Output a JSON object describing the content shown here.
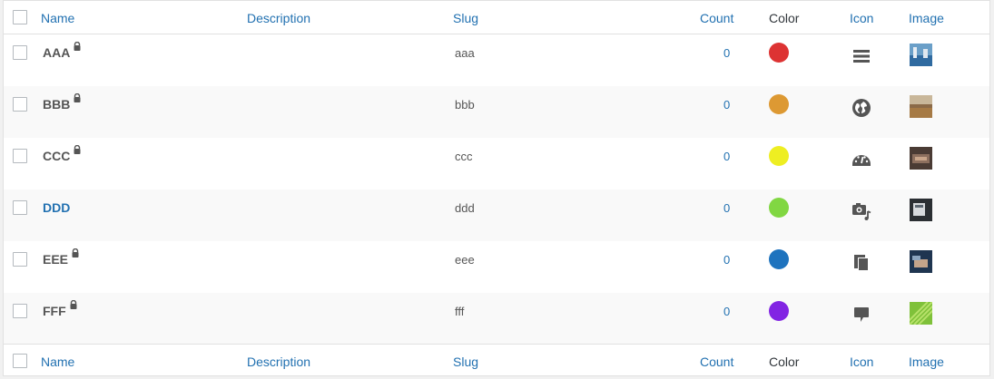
{
  "columns": {
    "name": "Name",
    "description": "Description",
    "slug": "Slug",
    "count": "Count",
    "color": "Color",
    "icon": "Icon",
    "image": "Image"
  },
  "rows": [
    {
      "name": "AAA",
      "slug": "aaa",
      "count": "0",
      "color": "#dd3333",
      "icon": "menu-icon",
      "locked": true
    },
    {
      "name": "BBB",
      "slug": "bbb",
      "count": "0",
      "color": "#dd9933",
      "icon": "globe-icon",
      "locked": true
    },
    {
      "name": "CCC",
      "slug": "ccc",
      "count": "0",
      "color": "#eeee22",
      "icon": "dashboard-icon",
      "locked": true
    },
    {
      "name": "DDD",
      "slug": "ddd",
      "count": "0",
      "color": "#81d742",
      "icon": "media-icon",
      "locked": false
    },
    {
      "name": "EEE",
      "slug": "eee",
      "count": "0",
      "color": "#1e73be",
      "icon": "copy-icon",
      "locked": true
    },
    {
      "name": "FFF",
      "slug": "fff",
      "count": "0",
      "color": "#8224e3",
      "icon": "comment-icon",
      "locked": true
    }
  ]
}
